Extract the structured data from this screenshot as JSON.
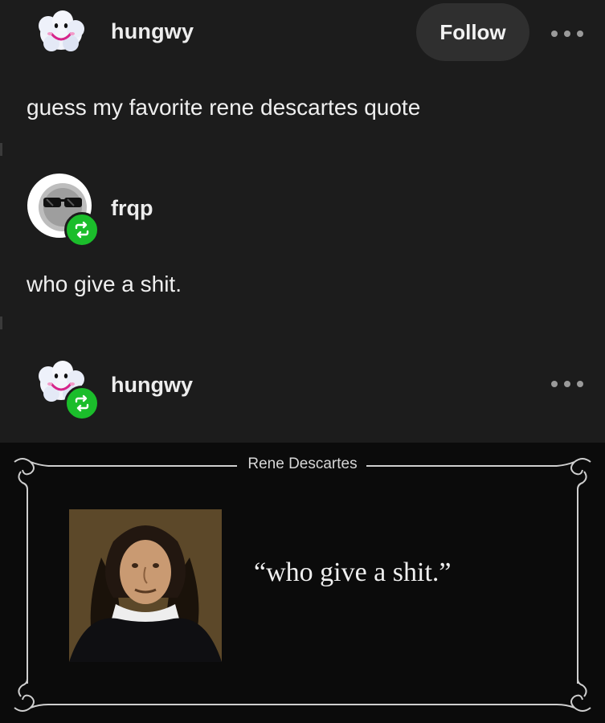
{
  "post": {
    "author": "hungwy",
    "follow_label": "Follow",
    "text": "guess my favorite rene descartes quote"
  },
  "reblogs": [
    {
      "author": "frqp",
      "text": "who give a shit."
    },
    {
      "author": "hungwy"
    }
  ],
  "meme": {
    "title": "Rene Descartes",
    "quote": "“who give a shit.”"
  },
  "colors": {
    "background": "#1c1c1c",
    "follow_button": "#2f2f2f",
    "reblog_badge": "#1bbd2b",
    "meme_background": "#0b0b0b"
  },
  "icons": {
    "more": "more-options-icon",
    "reblog": "reblog-icon"
  }
}
